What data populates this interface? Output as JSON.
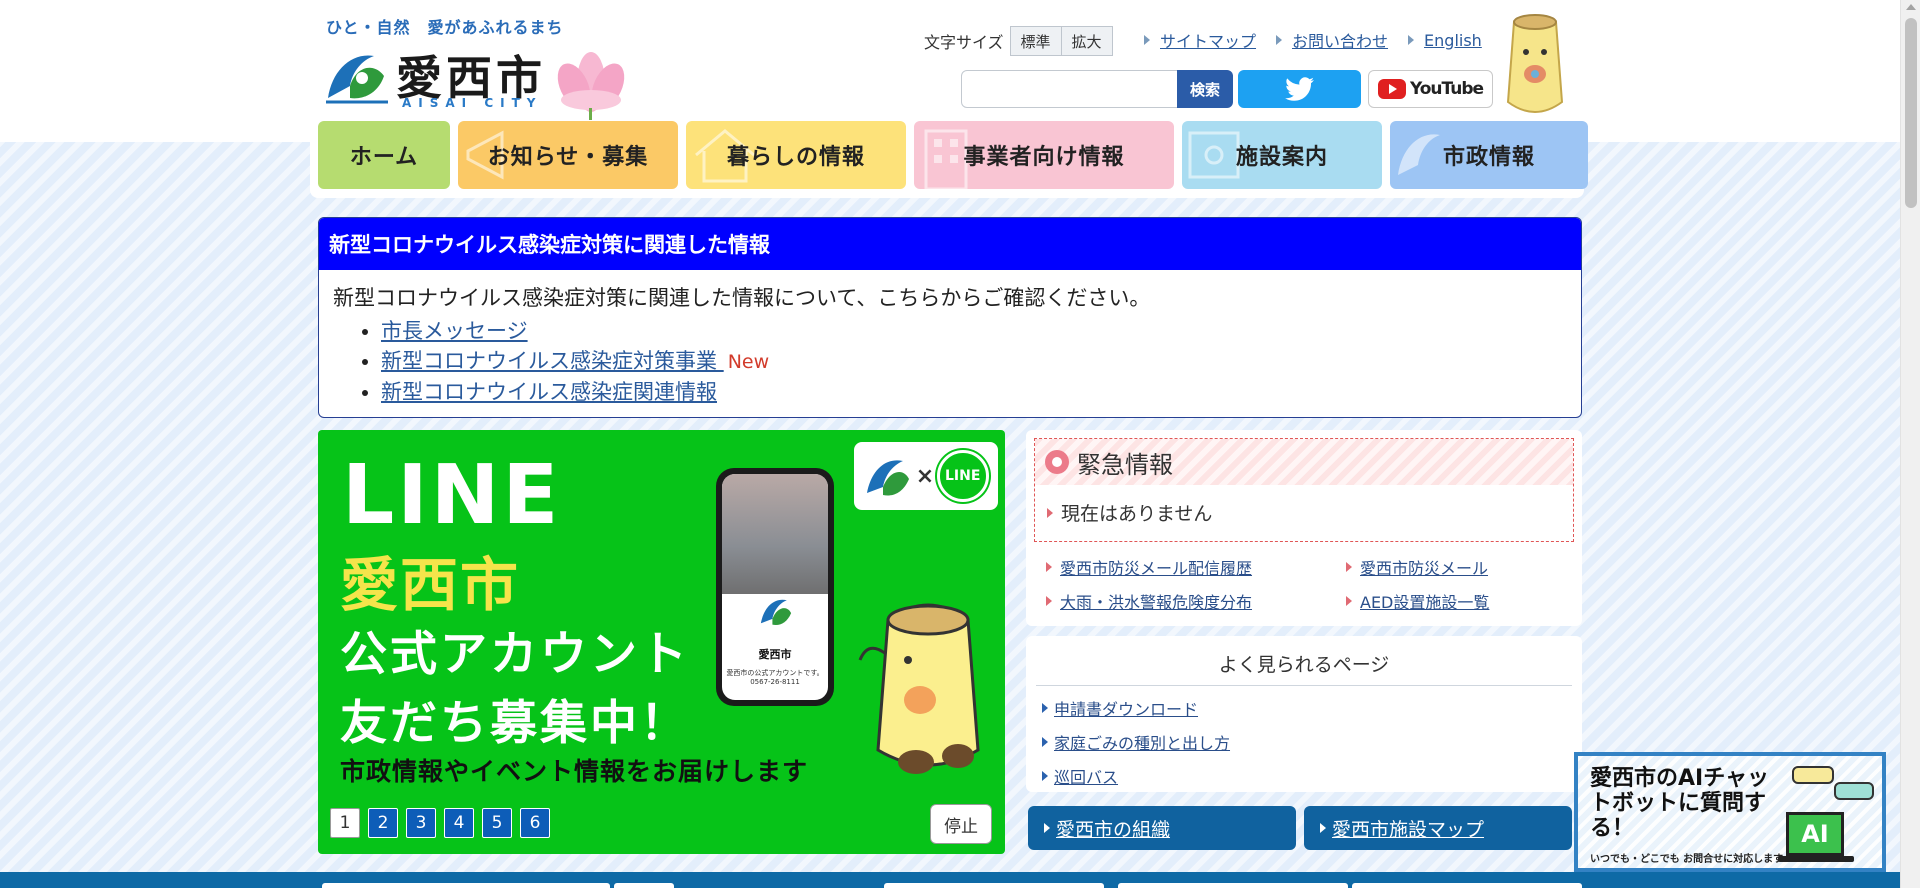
{
  "header": {
    "tagline": "ひと・自然　愛があふれるまち",
    "logo_name": "愛西市",
    "logo_sub": "AISAI CITY",
    "font_size_label": "文字サイズ",
    "font_size_options": [
      "標準",
      "拡大"
    ],
    "links": [
      "サイトマップ",
      "お問い合わせ",
      "English"
    ],
    "search_button": "検索",
    "youtube_label": "YouTube"
  },
  "nav": [
    {
      "label": "ホーム",
      "color": "#b6dc70"
    },
    {
      "label": "お知らせ・募集",
      "color": "#fbc966"
    },
    {
      "label": "暮らしの情報",
      "color": "#fde27a"
    },
    {
      "label": "事業者向け情報",
      "color": "#f9c5d3"
    },
    {
      "label": "施設案内",
      "color": "#a9dcf1"
    },
    {
      "label": "市政情報",
      "color": "#9dc5f4"
    }
  ],
  "corona": {
    "title": "新型コロナウイルス感染症対策に関連した情報",
    "text": "新型コロナウイルス感染症対策に関連した情報について、こちらからご確認ください。",
    "links": [
      "市長メッセージ",
      "新型コロナウイルス感染症対策事業 ",
      "新型コロナウイルス感染症関連情報"
    ],
    "new_badge": "New"
  },
  "banner": {
    "line": "LINE",
    "city": "愛西市",
    "account": "公式アカウント",
    "friends": "友だち募集中！",
    "sub": "市政情報やイベント情報をお届けします",
    "line_logo": "LINE",
    "times": "×",
    "phone_name": "愛西市",
    "phone_desc": "愛西市の公式アカウントです。0567-26-8111",
    "pages": [
      "1",
      "2",
      "3",
      "4",
      "5",
      "6"
    ],
    "stop": "停止"
  },
  "emergency": {
    "title": "緊急情報",
    "none": "現在はありません",
    "links": [
      "愛西市防災メール配信履歴",
      "愛西市防災メール",
      "大雨・洪水警報危険度分布",
      "AED設置施設一覧"
    ]
  },
  "popular": {
    "title": "よく見られるページ",
    "links": [
      "申請書ダウンロード",
      "家庭ごみの種別と出し方",
      "巡回バス"
    ]
  },
  "buttons": [
    "愛西市の組織",
    "愛西市施設マップ"
  ],
  "chatbot": {
    "title": "愛西市のAIチャットボットに質問する！",
    "sub": "いつでも・どこでも お問合せに対応します",
    "ai": "AI"
  }
}
